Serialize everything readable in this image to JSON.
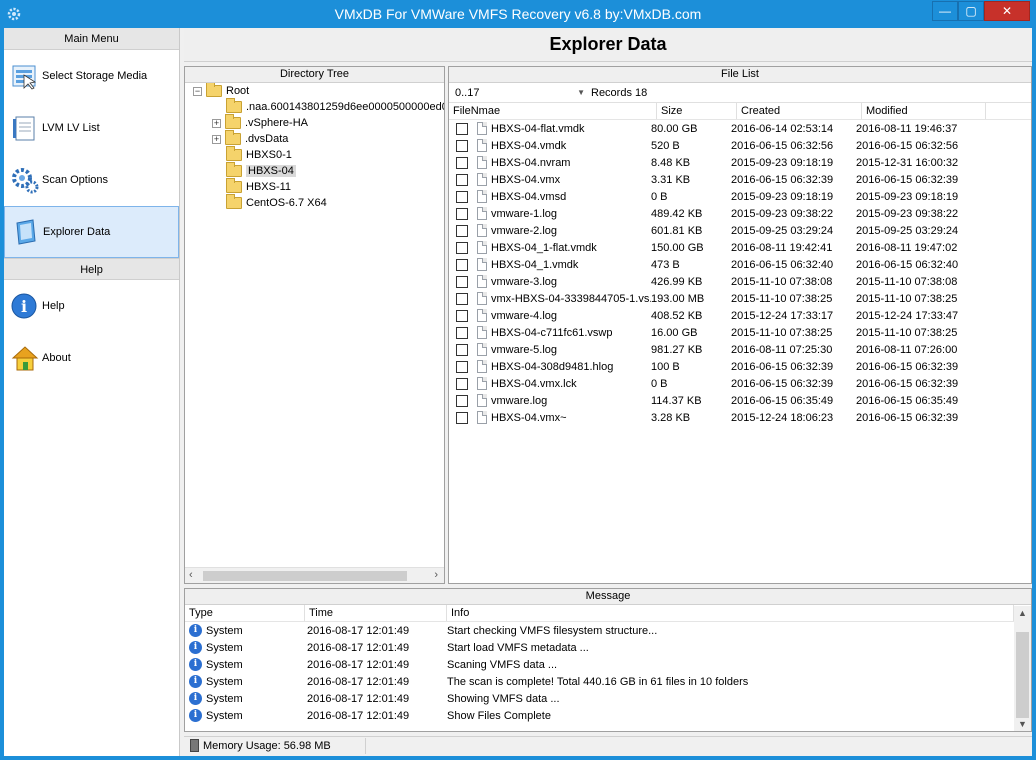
{
  "window": {
    "title": "VMxDB For VMWare VMFS Recovery v6.8 by:VMxDB.com",
    "controls": {
      "minimize": "—",
      "maximize": "▢",
      "close": "✕"
    }
  },
  "sidebar": {
    "main_menu_header": "Main Menu",
    "items": [
      {
        "label": "Select Storage Media",
        "icon": "storage-media-icon"
      },
      {
        "label": "LVM LV List",
        "icon": "lvm-list-icon"
      },
      {
        "label": "Scan Options",
        "icon": "gear-icon"
      },
      {
        "label": "Explorer Data",
        "icon": "explorer-icon",
        "active": true
      }
    ],
    "help_header": "Help",
    "help_items": [
      {
        "label": "Help",
        "icon": "info-icon"
      },
      {
        "label": "About",
        "icon": "home-icon"
      }
    ]
  },
  "page_title": "Explorer Data",
  "directory_tree": {
    "header": "Directory Tree",
    "root": "Root",
    "nodes": [
      {
        "label": ".naa.600143801259d6ee0000500000ed0",
        "expander": ""
      },
      {
        "label": ".vSphere-HA",
        "expander": "+"
      },
      {
        "label": ".dvsData",
        "expander": "+"
      },
      {
        "label": "HBXS0-1",
        "expander": ""
      },
      {
        "label": "HBXS-04",
        "expander": "",
        "selected": true
      },
      {
        "label": "HBXS-11",
        "expander": ""
      },
      {
        "label": "CentOS-6.7 X64",
        "expander": ""
      }
    ]
  },
  "file_list": {
    "header": "File List",
    "range": "0..17",
    "records": "Records 18",
    "columns": [
      "FileNmae",
      "Size",
      "Created",
      "Modified"
    ],
    "rows": [
      [
        "HBXS-04-flat.vmdk",
        "80.00 GB",
        "2016-06-14 02:53:14",
        "2016-08-11 19:46:37"
      ],
      [
        "HBXS-04.vmdk",
        "520 B",
        "2016-06-15 06:32:56",
        "2016-06-15 06:32:56"
      ],
      [
        "HBXS-04.nvram",
        "8.48 KB",
        "2015-09-23 09:18:19",
        "2015-12-31 16:00:32"
      ],
      [
        "HBXS-04.vmx",
        "3.31 KB",
        "2016-06-15 06:32:39",
        "2016-06-15 06:32:39"
      ],
      [
        "HBXS-04.vmsd",
        "0 B",
        "2015-09-23 09:18:19",
        "2015-09-23 09:18:19"
      ],
      [
        "vmware-1.log",
        "489.42 KB",
        "2015-09-23 09:38:22",
        "2015-09-23 09:38:22"
      ],
      [
        "vmware-2.log",
        "601.81 KB",
        "2015-09-25 03:29:24",
        "2015-09-25 03:29:24"
      ],
      [
        "HBXS-04_1-flat.vmdk",
        "150.00 GB",
        "2016-08-11 19:42:41",
        "2016-08-11 19:47:02"
      ],
      [
        "HBXS-04_1.vmdk",
        "473 B",
        "2016-06-15 06:32:40",
        "2016-06-15 06:32:40"
      ],
      [
        "vmware-3.log",
        "426.99 KB",
        "2015-11-10 07:38:08",
        "2015-11-10 07:38:08"
      ],
      [
        "vmx-HBXS-04-3339844705-1.vs...",
        "193.00 MB",
        "2015-11-10 07:38:25",
        "2015-11-10 07:38:25"
      ],
      [
        "vmware-4.log",
        "408.52 KB",
        "2015-12-24 17:33:17",
        "2015-12-24 17:33:47"
      ],
      [
        "HBXS-04-c711fc61.vswp",
        "16.00 GB",
        "2015-11-10 07:38:25",
        "2015-11-10 07:38:25"
      ],
      [
        "vmware-5.log",
        "981.27 KB",
        "2016-08-11 07:25:30",
        "2016-08-11 07:26:00"
      ],
      [
        "HBXS-04-308d9481.hlog",
        "100 B",
        "2016-06-15 06:32:39",
        "2016-06-15 06:32:39"
      ],
      [
        "HBXS-04.vmx.lck",
        "0 B",
        "2016-06-15 06:32:39",
        "2016-06-15 06:32:39"
      ],
      [
        "vmware.log",
        "114.37 KB",
        "2016-06-15 06:35:49",
        "2016-06-15 06:35:49"
      ],
      [
        "HBXS-04.vmx~",
        "3.28 KB",
        "2015-12-24 18:06:23",
        "2016-06-15 06:32:39"
      ]
    ]
  },
  "message": {
    "header": "Message",
    "columns": [
      "Type",
      "Time",
      "Info"
    ],
    "rows": [
      [
        "System",
        "2016-08-17 12:01:49",
        "Start checking VMFS filesystem structure..."
      ],
      [
        "System",
        "2016-08-17 12:01:49",
        "Start load VMFS metadata ..."
      ],
      [
        "System",
        "2016-08-17 12:01:49",
        "Scaning VMFS data ..."
      ],
      [
        "System",
        "2016-08-17 12:01:49",
        "The scan is complete!  Total 440.16 GB  in 61 files in 10 folders"
      ],
      [
        "System",
        "2016-08-17 12:01:49",
        "Showing VMFS data ..."
      ],
      [
        "System",
        "2016-08-17 12:01:49",
        "Show Files Complete"
      ]
    ]
  },
  "status": {
    "memory": "Memory Usage: 56.98 MB"
  },
  "colors": {
    "titlebar": "#1c8fd9",
    "close": "#c7312a",
    "active_item": "#dcebfb"
  }
}
